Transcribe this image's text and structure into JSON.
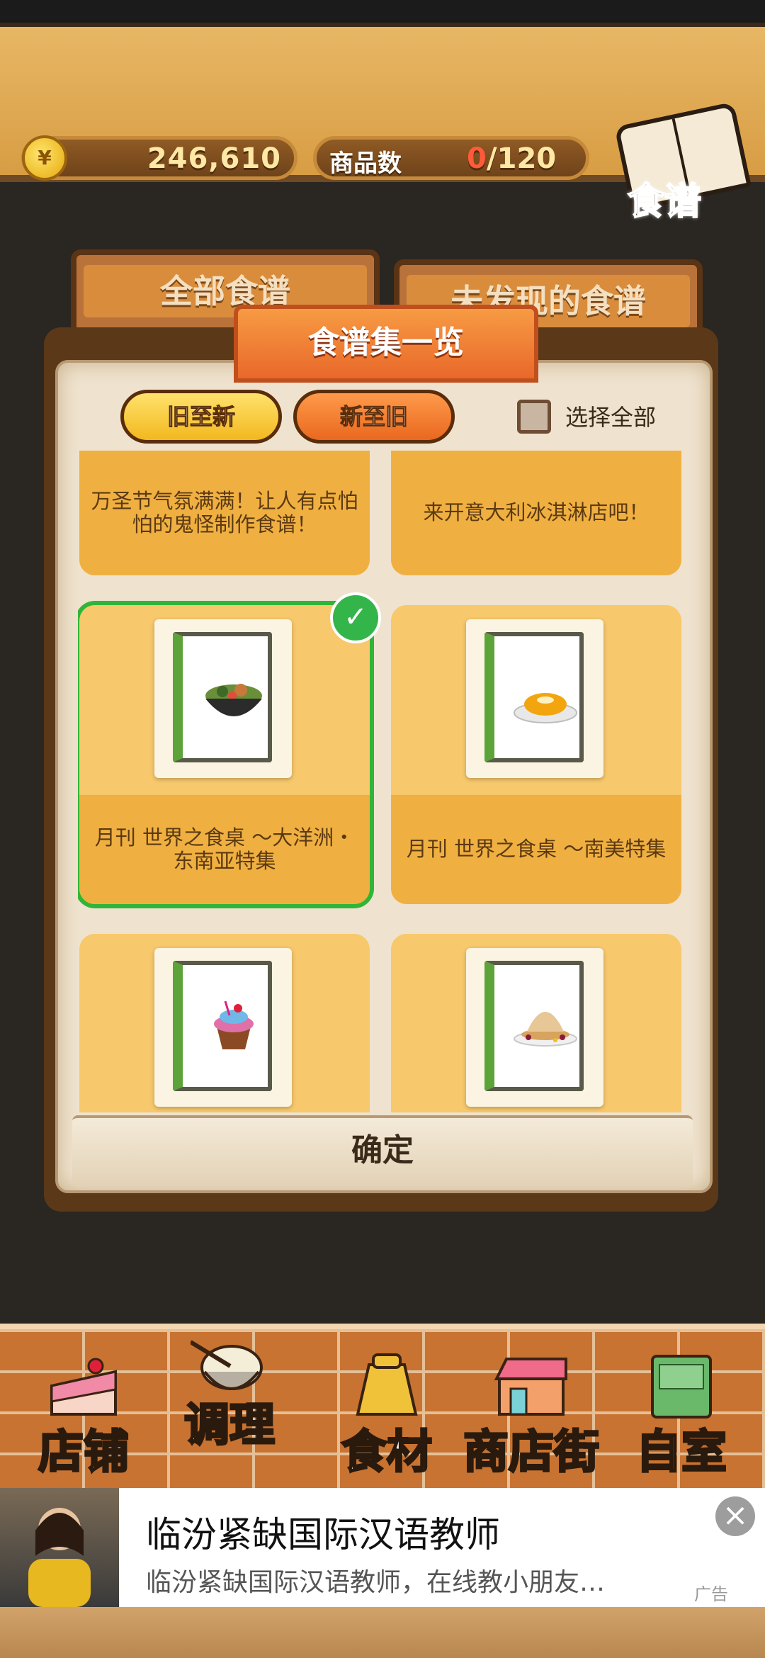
{
  "header": {
    "coins": "246,610",
    "coin_symbol": "¥",
    "item_count_label": "商品数",
    "item_count_current": "0",
    "item_count_max": "/120",
    "recipe_button_label": "食谱"
  },
  "back_tabs": {
    "all_recipes": "全部食谱",
    "undiscovered": "未发现的食谱"
  },
  "dialog": {
    "title": "食谱集一览",
    "sort_old_to_new": "旧至新",
    "sort_new_to_old": "新至旧",
    "select_all": "选择全部",
    "confirm": "确定",
    "cards": [
      {
        "desc": "万圣节气氛满满！让人有点怕怕的鬼怪制作食谱！",
        "selected": false
      },
      {
        "desc": "来开意大利冰淇淋店吧！",
        "selected": false
      },
      {
        "desc": "月刊 世界之食桌 ～大洋洲・东南亚特集",
        "selected": true,
        "food": "noodle-bowl"
      },
      {
        "desc": "月刊 世界之食桌 ～南美特集",
        "selected": false,
        "food": "custard-flan"
      },
      {
        "desc": "",
        "selected": false,
        "food": "cupcake"
      },
      {
        "desc": "",
        "selected": false,
        "food": "mont-blanc-pancake"
      }
    ]
  },
  "nav": {
    "items": [
      {
        "label": "店铺",
        "icon": "cake-shop-icon"
      },
      {
        "label": "调理",
        "icon": "mixing-bowl-icon"
      },
      {
        "label": "食材",
        "icon": "flour-sack-icon"
      },
      {
        "label": "商店街",
        "icon": "storefront-icon"
      },
      {
        "label": "自室",
        "icon": "staff-only-door-icon"
      }
    ]
  },
  "ad": {
    "title": "临汾紧缺国际汉语教师",
    "subtitle": "临汾紧缺国际汉语教师，在线教小朋友…",
    "tag": "广告",
    "close": "×"
  },
  "colors": {
    "accent_orange": "#e9682a",
    "card_yellow": "#f7c86c",
    "selected_green": "#30b538"
  }
}
